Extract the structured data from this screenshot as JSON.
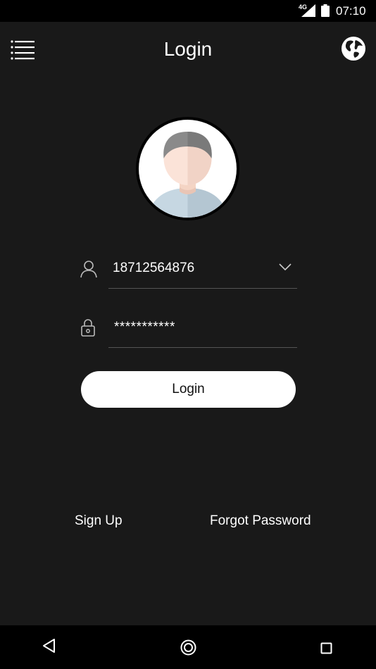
{
  "status_bar": {
    "network": "4G",
    "time": "07:10"
  },
  "header": {
    "title": "Login",
    "menu_icon": "hamburger-menu-icon",
    "language_icon": "globe-icon"
  },
  "login_form": {
    "account_value": "18712564876",
    "password_display": "***********",
    "login_label": "Login"
  },
  "links": {
    "sign_up": "Sign Up",
    "forgot_password": "Forgot Password"
  },
  "colors": {
    "background": "#191919",
    "bars": "#000000",
    "button_bg": "#ffffff",
    "divider": "#555555"
  }
}
